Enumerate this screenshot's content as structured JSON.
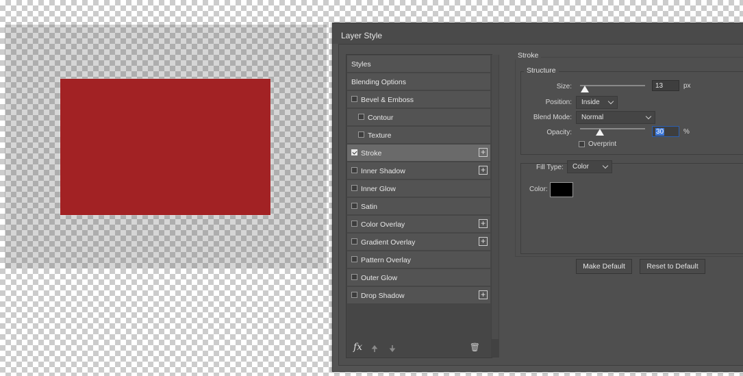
{
  "canvas": {
    "shape_color": "#a22224"
  },
  "dialog": {
    "title": "Layer Style",
    "styles_panel": {
      "items": [
        {
          "label": "Styles",
          "checkbox": false,
          "checked": false,
          "add": false,
          "active": false
        },
        {
          "label": "Blending Options",
          "checkbox": false,
          "checked": false,
          "add": false,
          "active": false
        },
        {
          "label": "Bevel & Emboss",
          "checkbox": true,
          "checked": false,
          "add": false,
          "active": false
        },
        {
          "label": "Contour",
          "checkbox": true,
          "checked": false,
          "add": false,
          "active": false,
          "indent": true
        },
        {
          "label": "Texture",
          "checkbox": true,
          "checked": false,
          "add": false,
          "active": false,
          "indent": true
        },
        {
          "label": "Stroke",
          "checkbox": true,
          "checked": true,
          "add": true,
          "active": true
        },
        {
          "label": "Inner Shadow",
          "checkbox": true,
          "checked": false,
          "add": true,
          "active": false
        },
        {
          "label": "Inner Glow",
          "checkbox": true,
          "checked": false,
          "add": false,
          "active": false
        },
        {
          "label": "Satin",
          "checkbox": true,
          "checked": false,
          "add": false,
          "active": false
        },
        {
          "label": "Color Overlay",
          "checkbox": true,
          "checked": false,
          "add": true,
          "active": false
        },
        {
          "label": "Gradient Overlay",
          "checkbox": true,
          "checked": false,
          "add": true,
          "active": false
        },
        {
          "label": "Pattern Overlay",
          "checkbox": true,
          "checked": false,
          "add": false,
          "active": false
        },
        {
          "label": "Outer Glow",
          "checkbox": true,
          "checked": false,
          "add": false,
          "active": false
        },
        {
          "label": "Drop Shadow",
          "checkbox": true,
          "checked": false,
          "add": true,
          "active": false
        }
      ],
      "footer": {
        "fx_label": "fx",
        "move_up_icon": "arrow-up-icon",
        "move_down_icon": "arrow-down-icon",
        "delete_icon": "trash-icon"
      }
    },
    "stroke": {
      "section_title": "Stroke",
      "structure_title": "Structure",
      "size_label": "Size:",
      "size_value": "13",
      "size_unit": "px",
      "size_slider_fraction": 0.07,
      "position_label": "Position:",
      "position_value": "Inside",
      "blend_mode_label": "Blend Mode:",
      "blend_mode_value": "Normal",
      "opacity_label": "Opacity:",
      "opacity_value": "30",
      "opacity_unit": "%",
      "opacity_slider_fraction": 0.3,
      "overprint_label": "Overprint",
      "overprint_checked": false,
      "fill_type_label": "Fill Type:",
      "fill_type_value": "Color",
      "color_label": "Color:",
      "color_value": "#000000"
    },
    "buttons": {
      "make_default": "Make Default",
      "reset_to_default": "Reset to Default"
    }
  }
}
